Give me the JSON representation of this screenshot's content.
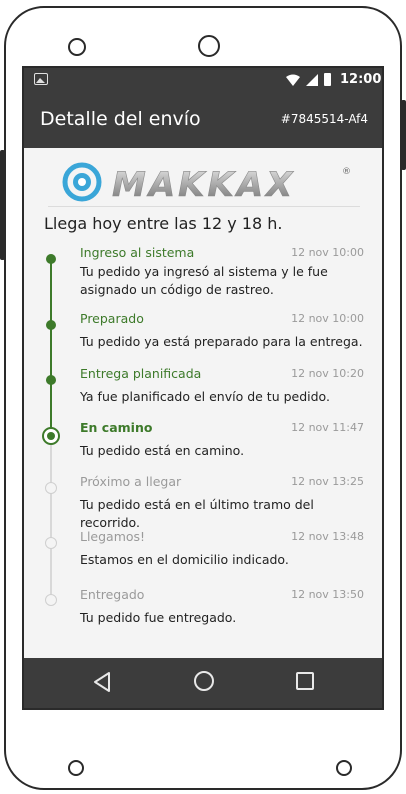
{
  "status_bar": {
    "time": "12:00",
    "icons": [
      "image-icon",
      "wifi-icon",
      "signal-icon",
      "battery-icon"
    ]
  },
  "app_bar": {
    "title": "Detalle del envío",
    "order_id": "#7845514-Af4"
  },
  "brand": {
    "logo_text": "MAKKAX",
    "logo_mark": "®"
  },
  "eta_text": "Llega hoy entre las 12 y 18 h.",
  "timeline": [
    {
      "title": "Ingreso al sistema",
      "time": "12 nov 10:00",
      "desc": "Tu pedido ya ingresó al sistema y le fue asignado un código de rastreo.",
      "state": "done"
    },
    {
      "title": "Preparado",
      "time": "12 nov 10:00",
      "desc": "Tu pedido ya está preparado para la entrega.",
      "state": "done"
    },
    {
      "title": "Entrega planificada",
      "time": "12 nov 10:20",
      "desc": "Ya fue planificado el envío de tu pedido.",
      "state": "done"
    },
    {
      "title": "En camino",
      "time": "12 nov 11:47",
      "desc": "Tu pedido está en camino.",
      "state": "current"
    },
    {
      "title": "Próximo a llegar",
      "time": "12 nov 13:25",
      "desc": "Tu pedido está en el último tramo del recorrido.",
      "state": "pending"
    },
    {
      "title": "Llegamos!",
      "time": "12 nov 13:48",
      "desc": "Estamos en el domicilio indicado.",
      "state": "pending"
    },
    {
      "title": "Entregado",
      "time": "12 nov 13:50",
      "desc": "Tu pedido fue entregado.",
      "state": "pending"
    }
  ],
  "colors": {
    "done": "#3d7a2a",
    "pending": "#9a9a9a",
    "bar": "#3c3c3c"
  },
  "nav": {
    "icons": [
      "back-icon",
      "home-icon",
      "recent-apps-icon"
    ]
  }
}
